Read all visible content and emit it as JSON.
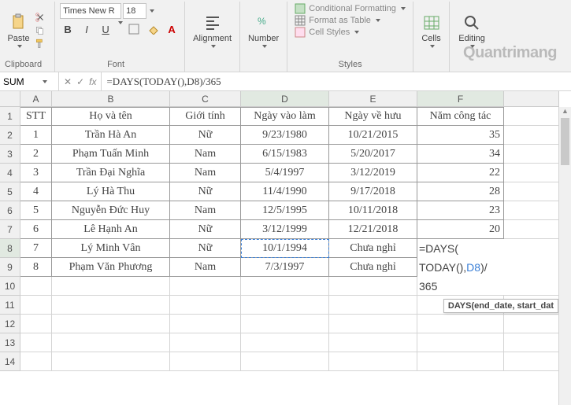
{
  "ribbon": {
    "clipboard": {
      "label": "Clipboard",
      "paste": "Paste"
    },
    "font": {
      "label": "Font",
      "name": "Times New R",
      "size": "18",
      "bold": "B",
      "italic": "I",
      "underline": "U"
    },
    "alignment": {
      "label": "Alignment"
    },
    "number": {
      "label": "Number"
    },
    "styles": {
      "label": "Styles",
      "cond": "Conditional Formatting",
      "table": "Format as Table",
      "cell": "Cell Styles"
    },
    "cells": {
      "label": "Cells"
    },
    "editing": {
      "label": "Editing"
    }
  },
  "formulaBar": {
    "nameBox": "SUM",
    "formula": "=DAYS(TODAY(),D8)/365"
  },
  "columns": [
    "A",
    "B",
    "C",
    "D",
    "E",
    "F"
  ],
  "headers": {
    "stt": "STT",
    "name": "Họ và tên",
    "gender": "Giới tính",
    "start": "Ngày vào làm",
    "end": "Ngày về hưu",
    "years": "Năm công tác"
  },
  "rows": [
    {
      "n": "1",
      "name": "Trần Hà An",
      "g": "Nữ",
      "s": "9/23/1980",
      "e": "10/21/2015",
      "y": "35"
    },
    {
      "n": "2",
      "name": "Phạm Tuấn Minh",
      "g": "Nam",
      "s": "6/15/1983",
      "e": "5/20/2017",
      "y": "34"
    },
    {
      "n": "3",
      "name": "Trần Đại Nghĩa",
      "g": "Nam",
      "s": "5/4/1997",
      "e": "3/12/2019",
      "y": "22"
    },
    {
      "n": "4",
      "name": "Lý Hà Thu",
      "g": "Nữ",
      "s": "11/4/1990",
      "e": "9/17/2018",
      "y": "28"
    },
    {
      "n": "5",
      "name": "Nguyễn Đức Huy",
      "g": "Nam",
      "s": "12/5/1995",
      "e": "10/11/2018",
      "y": "23"
    },
    {
      "n": "6",
      "name": "Lê Hạnh An",
      "g": "Nữ",
      "s": "3/12/1999",
      "e": "12/21/2018",
      "y": "20"
    },
    {
      "n": "7",
      "name": "Lý Minh Vân",
      "g": "Nữ",
      "s": "10/1/1994",
      "e": "Chưa nghỉ",
      "y": ""
    },
    {
      "n": "8",
      "name": "Phạm Văn Phương",
      "g": "Nam",
      "s": "7/3/1997",
      "e": "Chưa nghỉ",
      "y": ""
    }
  ],
  "editing": {
    "line1": "=DAYS(",
    "line2_a": "TODAY",
    "line2_b": "(),",
    "line2_c": "D8",
    "line2_d": ")/",
    "line3": "365"
  },
  "tooltip": "DAYS(end_date, start_dat",
  "watermark": "Quantrimang"
}
